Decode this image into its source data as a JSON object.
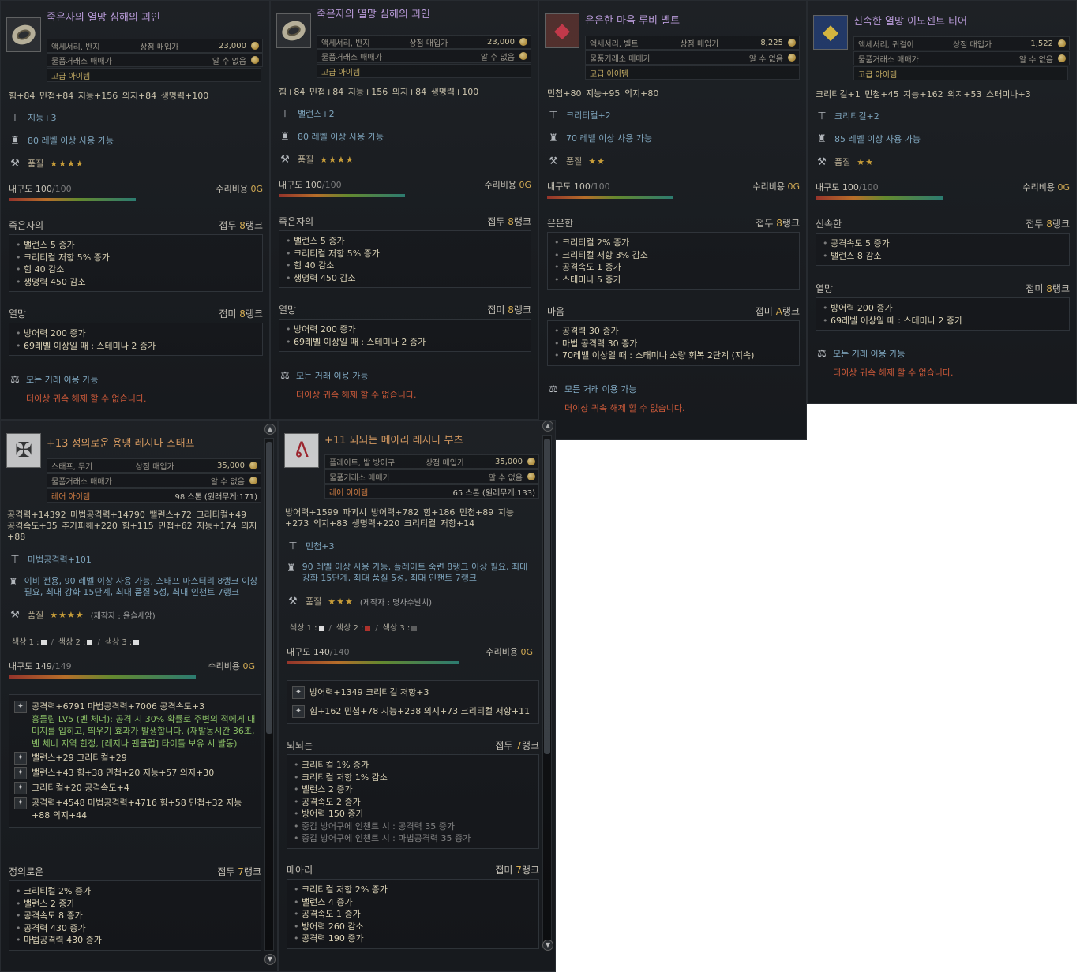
{
  "t1": {
    "title": "죽은자의 열망 심해의 괴인",
    "type": "액세서리, 반지",
    "shop_label": "상점 매입가",
    "shop_price": "23,000",
    "market_label": "물품거래소 매매가",
    "market_value": "알 수 없음",
    "grade": "고급 아이템",
    "stats": "힘+84  민첩+84  지능+156  의지+84  생명력+100",
    "sub": "지능+3",
    "level": "80 레벨 이상 사용 가능",
    "quality_label": "품질",
    "stars": "★★★★",
    "dura_label": "내구도",
    "dura_cur": "100",
    "dura_max": "/100",
    "repair_label": "수리비용",
    "repair_val": "0G",
    "s1": {
      "name": "죽은자의",
      "rank_pre": "접두",
      "rank_val": "8",
      "rank_suf": "랭크",
      "lines": [
        "밸런스 5 증가",
        "크리티컬 저항 5% 증가",
        "힘 40 감소",
        "생명력 450 감소"
      ]
    },
    "s2": {
      "name": "열망",
      "rank_pre": "접미",
      "rank_val": "8",
      "rank_suf": "랭크",
      "lines": [
        "방어력 200 증가",
        "69레벨 이상일 때 : 스테미나 2 증가"
      ]
    },
    "trade": "모든 거래 이용 가능",
    "bind": "더이상 귀속 해제 할 수 없습니다."
  },
  "t2": {
    "title": "죽은자의 열망 심해의 괴인",
    "type": "액세서리, 반지",
    "shop_label": "상점 매입가",
    "shop_price": "23,000",
    "market_label": "물품거래소 매매가",
    "market_value": "알 수 없음",
    "grade": "고급 아이템",
    "stats": "힘+84  민첩+84  지능+156  의지+84  생명력+100",
    "sub": "밸런스+2",
    "level": "80 레벨 이상 사용 가능",
    "quality_label": "품질",
    "stars": "★★★★",
    "dura_label": "내구도",
    "dura_cur": "100",
    "dura_max": "/100",
    "repair_label": "수리비용",
    "repair_val": "0G",
    "s1": {
      "name": "죽은자의",
      "rank_pre": "접두",
      "rank_val": "8",
      "rank_suf": "랭크",
      "lines": [
        "밸런스 5 증가",
        "크리티컬 저항 5% 증가",
        "힘 40 감소",
        "생명력 450 감소"
      ]
    },
    "s2": {
      "name": "열망",
      "rank_pre": "접미",
      "rank_val": "8",
      "rank_suf": "랭크",
      "lines": [
        "방어력 200 증가",
        "69레벨 이상일 때 : 스테미나 2 증가"
      ]
    },
    "trade": "모든 거래 이용 가능",
    "bind": "더이상 귀속 해제 할 수 없습니다."
  },
  "t3": {
    "title": "은은한 마음 루비 벨트",
    "type": "액세서리, 벨트",
    "shop_label": "상점 매입가",
    "shop_price": "8,225",
    "market_label": "물품거래소 매매가",
    "market_value": "알 수 없음",
    "grade": "고급 아이템",
    "stats": "민첩+80  지능+95  의지+80",
    "sub": "크리티컬+2",
    "level": "70 레벨 이상 사용 가능",
    "quality_label": "품질",
    "stars": "★★",
    "dura_label": "내구도",
    "dura_cur": "100",
    "dura_max": "/100",
    "repair_label": "수리비용",
    "repair_val": "0G",
    "s1": {
      "name": "은은한",
      "rank_pre": "접두",
      "rank_val": "8",
      "rank_suf": "랭크",
      "lines": [
        "크리티컬 2% 증가",
        "크리티컬 저항 3% 감소",
        "공격속도 1 증가",
        "스태미나 5 증가"
      ]
    },
    "s2": {
      "name": "마음",
      "rank_pre": "접미",
      "rank_val": "A",
      "rank_suf": "랭크",
      "lines": [
        "공격력 30 증가",
        "마법 공격력 30 증가",
        "70레벨 이상일 때 : 스태미나 소량 회복 2단계 (지속)"
      ]
    },
    "trade": "모든 거래 이용 가능",
    "bind": "더이상 귀속 해제 할 수 없습니다."
  },
  "t4": {
    "title": "신속한 열망 이노센트 티어",
    "type": "액세서리, 귀걸이",
    "shop_label": "상점 매입가",
    "shop_price": "1,522",
    "market_label": "물품거래소 매매가",
    "market_value": "알 수 없음",
    "grade": "고급 아이템",
    "stats": "크리티컬+1  민첩+45  지능+162  의지+53  스태미나+3",
    "sub": "크리티컬+2",
    "level": "85 레벨 이상 사용 가능",
    "quality_label": "품질",
    "stars": "★★",
    "dura_label": "내구도",
    "dura_cur": "100",
    "dura_max": "/100",
    "repair_label": "수리비용",
    "repair_val": "0G",
    "s1": {
      "name": "신속한",
      "rank_pre": "접두",
      "rank_val": "8",
      "rank_suf": "랭크",
      "lines": [
        "공격속도 5 증가",
        "밸런스 8 감소"
      ]
    },
    "s2": {
      "name": "열망",
      "rank_pre": "접미",
      "rank_val": "8",
      "rank_suf": "랭크",
      "lines": [
        "방어력 200 증가",
        "69레벨 이상일 때 : 스테미나 2 증가"
      ]
    },
    "trade": "모든 거래 이용 가능",
    "bind": "더이상 귀속 해제 할 수 없습니다."
  },
  "t5": {
    "title": "+13 정의로운 용맹 레지나 스태프",
    "type": "스태프, 무기",
    "shop_label": "상점 매입가",
    "shop_price": "35,000",
    "market_label": "물품거래소 매매가",
    "market_value": "알 수 없음",
    "grade": "레어 아이템",
    "weight": "98 스톤 (원래무게:171)",
    "stats": "공격력+14392  마법공격력+14790  밸런스+72  크리티컬+49  공격속도+35  추가피해+220  힘+115  민첩+62  지능+174  의지+88",
    "sub": "마법공격력+101",
    "level": "이비 전용, 90 레벨 이상 사용 가능, 스태프 마스터리 8랭크 이상 필요, 최대 강화 15단계, 최대 품질 5성, 최대 인챈트 7랭크",
    "quality_label": "품질",
    "stars": "★★★★",
    "maker": "(제작자 : 윤슬새암)",
    "c1": "색상 1 :",
    "c2": "색상 2 :",
    "c3": "색상 3 :",
    "dura_label": "내구도",
    "dura_cur": "149",
    "dura_max": "/149",
    "repair_label": "수리비용",
    "repair_val": "0G",
    "gem": [
      {
        "text": "공격력+6791  마법공격력+7006  공격속도+3",
        "extra": "흉들림 LV5 (벤 체너): 공격 시 30% 확률로 주변의 적에게 대미지를 입히고, 띄우기 효과가 발생합니다. (재발동시간 36초, 벤 체너 지역 한정, [레지나 팬클럽] 타이틀 보유 시 발동)"
      },
      {
        "text": "밸런스+29  크리티컬+29"
      },
      {
        "text": "밸런스+43  힘+38  민첩+20  지능+57  의지+30"
      },
      {
        "text": "크리티컬+20  공격속도+4"
      },
      {
        "text": "공격력+4548  마법공격력+4716  힘+58  민첩+32  지능+88  의지+44"
      }
    ],
    "s1": {
      "name": "정의로운",
      "rank_pre": "접두",
      "rank_val": "7",
      "rank_suf": "랭크",
      "lines": [
        "크리티컬 2% 증가",
        "밸런스 2 증가",
        "공격속도 8 증가",
        "공격력 430 증가",
        "마법공격력 430 증가"
      ]
    }
  },
  "t6": {
    "title": "+11 되뇌는 메아리 레지나 부츠",
    "type": "플레이트, 발 방어구",
    "shop_label": "상점 매입가",
    "shop_price": "35,000",
    "market_label": "물품거래소 매매가",
    "market_value": "알 수 없음",
    "grade": "레어 아이템",
    "weight": "65 스톤 (원래무게:133)",
    "stats": "방어력+1599  파괴시 방어력+782  힘+186  민첩+89  지능+273  의지+83  생명력+220  크리티컬 저항+14",
    "sub": "민첩+3",
    "level": "90 레벨 이상 사용 가능, 플레이트 숙련 8랭크 이상 필요, 최대 강화 15단계, 최대 품질 5성, 최대 인챈트 7랭크",
    "quality_label": "품질",
    "stars": "★★★",
    "maker": "(제작자 : 명사수날치)",
    "c1": "색상 1 :",
    "c2": "색상 2 :",
    "c3": "색상 3 :",
    "dura_label": "내구도",
    "dura_cur": "140",
    "dura_max": "/140",
    "repair_label": "수리비용",
    "repair_val": "0G",
    "gem": [
      {
        "text": "방어력+1349  크리티컬 저항+3"
      },
      {
        "text": "힘+162  민첩+78  지능+238  의지+73  크리티컬 저항+11"
      }
    ],
    "s1": {
      "name": "되뇌는",
      "rank_pre": "접두",
      "rank_val": "7",
      "rank_suf": "랭크",
      "lines": [
        "크리티컬 1% 증가",
        "크리티컬 저항 1% 감소",
        "밸런스 2 증가",
        "공격속도 2 증가",
        "방어력 150 증가"
      ],
      "dim": [
        "중갑 방어구에 인챈트 시 : 공격력 35 증가",
        "중갑 방어구에 인챈트 시 : 마법공격력 35 증가"
      ]
    },
    "s2": {
      "name": "메아리",
      "rank_pre": "접미",
      "rank_val": "7",
      "rank_suf": "랭크",
      "lines": [
        "크리티컬 저항 2% 증가",
        "밸런스 4 증가",
        "공격속도 1 증가",
        "방어력 260 감소",
        "공격력 190 증가"
      ]
    }
  }
}
